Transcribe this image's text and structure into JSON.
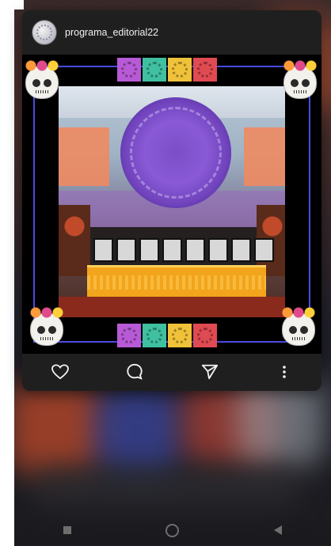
{
  "post": {
    "username": "programa_editorial22",
    "photo_alt": "Día de Muertos altar"
  },
  "actions": {
    "like": "heart-icon",
    "comment": "comment-icon",
    "share": "send-icon",
    "more": "more-vertical-icon"
  },
  "nav": {
    "recents": "square-icon",
    "home": "circle-icon",
    "back": "triangle-icon"
  },
  "colors": {
    "card_bg": "#1f1f1f",
    "frame_line": "#4a4ae0",
    "text": "#f2f2f2",
    "nav_icon": "#6e6e6e"
  }
}
